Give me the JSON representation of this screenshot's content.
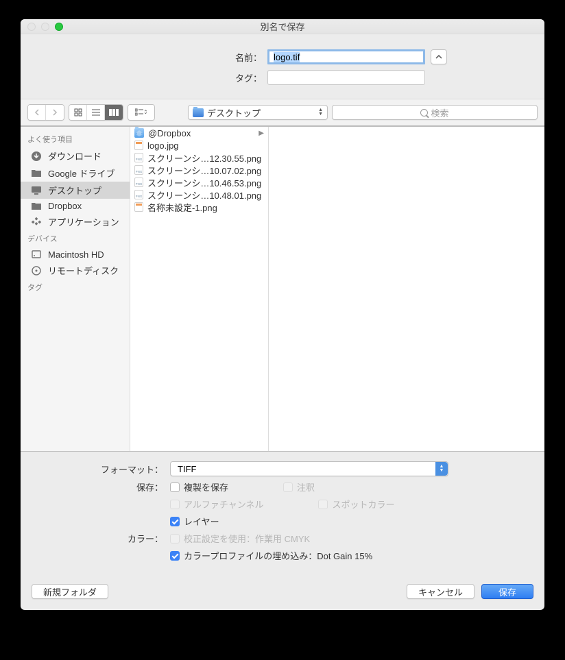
{
  "window": {
    "title": "別名で保存"
  },
  "name_row": {
    "label": "名前：",
    "value": "logo.tif"
  },
  "tag_row": {
    "label": "タグ："
  },
  "location": {
    "label": "デスクトップ"
  },
  "search": {
    "placeholder": "検索"
  },
  "sidebar": {
    "sections": [
      {
        "header": "よく使う項目",
        "items": [
          {
            "icon": "download",
            "label": "ダウンロード"
          },
          {
            "icon": "folder",
            "label": "Google ドライブ"
          },
          {
            "icon": "desktop",
            "label": "デスクトップ",
            "active": true
          },
          {
            "icon": "folder",
            "label": "Dropbox"
          },
          {
            "icon": "apps",
            "label": "アプリケーション"
          }
        ]
      },
      {
        "header": "デバイス",
        "items": [
          {
            "icon": "hdd",
            "label": "Macintosh HD"
          },
          {
            "icon": "disc",
            "label": "リモートディスク"
          }
        ]
      },
      {
        "header": "タグ",
        "items": []
      }
    ]
  },
  "files": [
    {
      "icon": "folder-db",
      "name": "@Dropbox",
      "hasChildren": true
    },
    {
      "icon": "img",
      "name": "logo.jpg"
    },
    {
      "icon": "png",
      "name": "スクリーンシ…12.30.55.png"
    },
    {
      "icon": "png",
      "name": "スクリーンシ…10.07.02.png"
    },
    {
      "icon": "png",
      "name": "スクリーンシ…10.46.53.png"
    },
    {
      "icon": "png",
      "name": "スクリーンシ…10.48.01.png"
    },
    {
      "icon": "img",
      "name": "名称未設定-1.png"
    }
  ],
  "format": {
    "label": "フォーマット：",
    "value": "TIFF"
  },
  "save_opts": {
    "label": "保存：",
    "copy": {
      "label": "複製を保存",
      "checked": false,
      "disabled": false
    },
    "notes": {
      "label": "注釈",
      "checked": false,
      "disabled": true
    },
    "alpha": {
      "label": "アルファチャンネル",
      "checked": false,
      "disabled": true
    },
    "spot": {
      "label": "スポットカラー",
      "checked": false,
      "disabled": true
    },
    "layers": {
      "label": "レイヤー",
      "checked": true,
      "disabled": false
    }
  },
  "color_opts": {
    "label": "カラー：",
    "proof": {
      "label": "校正設定を使用：作業用 CMYK",
      "checked": false,
      "disabled": true
    },
    "profile": {
      "label": "カラープロファイルの埋め込み：Dot Gain 15%",
      "checked": true,
      "disabled": false
    }
  },
  "buttons": {
    "new_folder": "新規フォルダ",
    "cancel": "キャンセル",
    "save": "保存"
  }
}
